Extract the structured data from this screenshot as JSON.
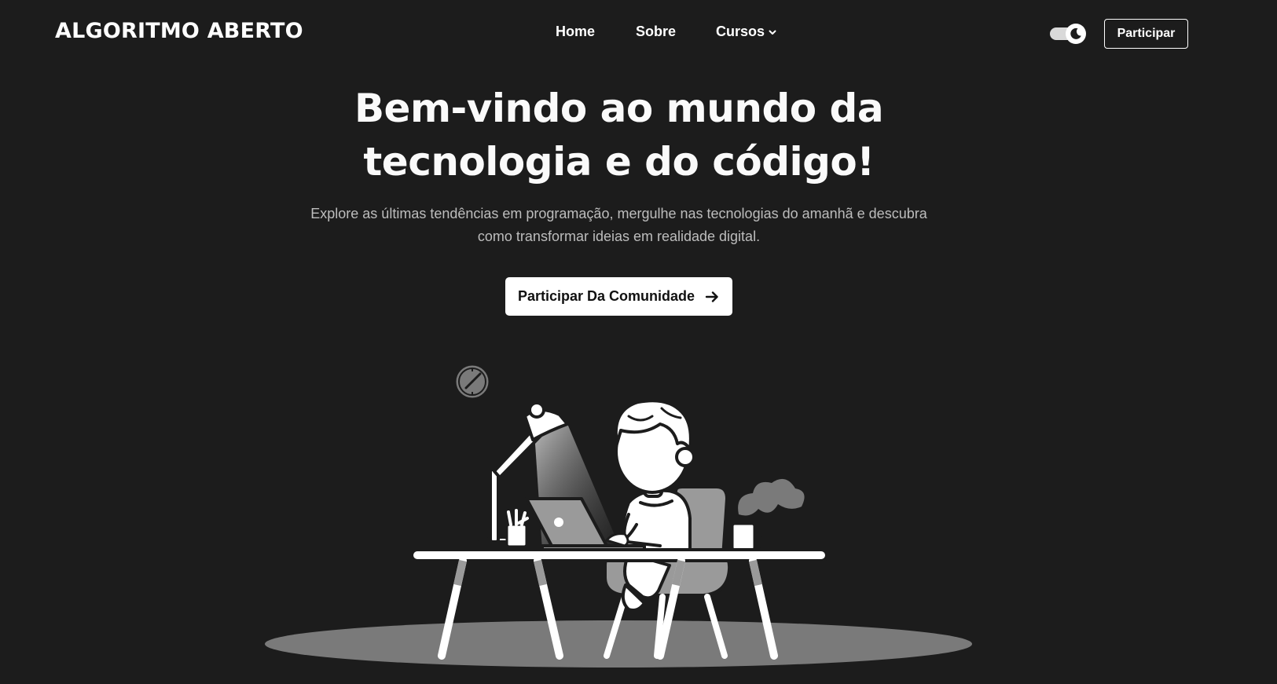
{
  "header": {
    "brand": "ALGORITMO ABERTO",
    "nav": {
      "home": "Home",
      "sobre": "Sobre",
      "cursos": "Cursos"
    },
    "theme_toggle_icon": "moon-icon",
    "join_label": "Participar"
  },
  "hero": {
    "title_line1": "Bem-vindo ao mundo da",
    "title_line2": "tecnologia e do código!",
    "subtitle": "Explore as últimas tendências em programação, mergulhe nas tecnologias do amanhã e descubra como transformar ideias em realidade digital.",
    "cta_label": "Participar Da Comunidade",
    "cta_icon": "arrow-right-icon"
  },
  "colors": {
    "background": "#1c1c1c",
    "text": "#ffffff",
    "muted_text": "#bdbdbd",
    "floor_shadow": "#7a7a7a"
  }
}
